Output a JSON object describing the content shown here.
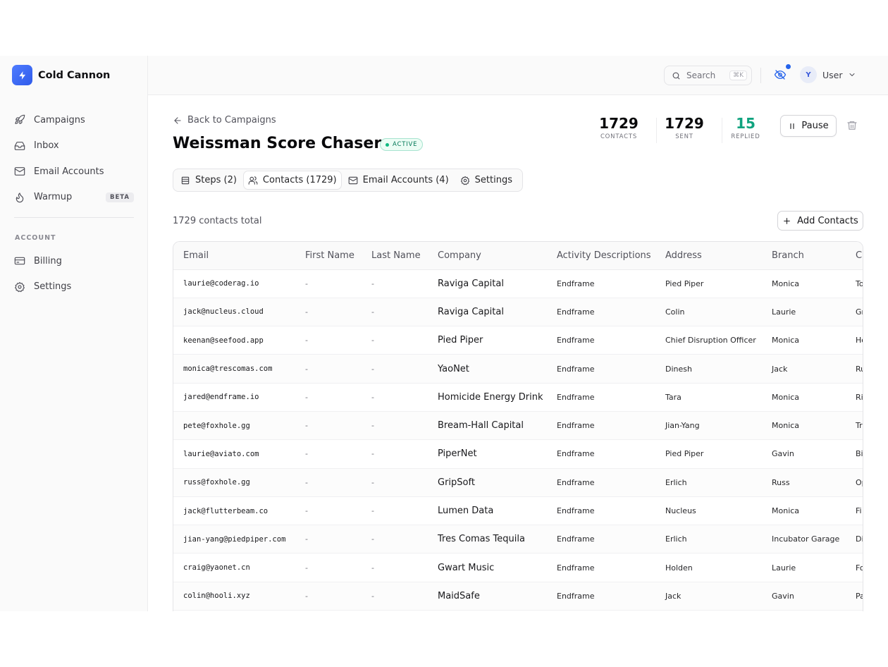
{
  "brand": {
    "name": "Cold Cannon"
  },
  "sidebar": {
    "items": [
      {
        "label": "Campaigns",
        "icon": "rocket-icon"
      },
      {
        "label": "Inbox",
        "icon": "inbox-icon"
      },
      {
        "label": "Email Accounts",
        "icon": "mail-icon"
      },
      {
        "label": "Warmup",
        "icon": "flame-icon",
        "badge": "BETA"
      }
    ],
    "section_label": "ACCOUNT",
    "account_items": [
      {
        "label": "Billing",
        "icon": "credit-card-icon"
      },
      {
        "label": "Settings",
        "icon": "gear-icon"
      }
    ]
  },
  "topbar": {
    "search_label": "Search",
    "search_shortcut": "⌘K",
    "user_initial": "Y",
    "user_label": "User"
  },
  "campaign": {
    "back_label": "Back to Campaigns",
    "title": "Weissman Score Chasers",
    "status": "ACTIVE",
    "stats": [
      {
        "value": "1729",
        "label": "CONTACTS"
      },
      {
        "value": "1729",
        "label": "SENT"
      },
      {
        "value": "15",
        "label": "REPLIED"
      }
    ],
    "pause_label": "Pause"
  },
  "tabs": [
    {
      "label": "Steps (2)",
      "icon": "list-icon",
      "active": false
    },
    {
      "label": "Contacts (1729)",
      "icon": "users-icon",
      "active": true
    },
    {
      "label": "Email Accounts (4)",
      "icon": "mail-icon",
      "active": false
    },
    {
      "label": "Settings",
      "icon": "gear-icon",
      "active": false
    }
  ],
  "contacts": {
    "total_label": "1729 contacts total",
    "add_label": "Add Contacts",
    "columns": [
      "Email",
      "First Name",
      "Last Name",
      "Company",
      "Activity Descriptions",
      "Address",
      "Branch",
      "C"
    ],
    "rows": [
      [
        "laurie@coderag.io",
        "-",
        "-",
        "Raviga Capital",
        "Endframe",
        "Pied Piper",
        "Monica",
        "To"
      ],
      [
        "jack@nucleus.cloud",
        "-",
        "-",
        "Raviga Capital",
        "Endframe",
        "Colin",
        "Laurie",
        "Gr"
      ],
      [
        "keenan@seefood.app",
        "-",
        "-",
        "Pied Piper",
        "Endframe",
        "Chief Disruption Officer",
        "Monica",
        "Ho"
      ],
      [
        "monica@trescomas.com",
        "-",
        "-",
        "YaoNet",
        "Endframe",
        "Dinesh",
        "Jack",
        "Ru"
      ],
      [
        "jared@endframe.io",
        "-",
        "-",
        "Homicide Energy Drink",
        "Endframe",
        "Tara",
        "Monica",
        "Ri"
      ],
      [
        "pete@foxhole.gg",
        "-",
        "-",
        "Bream-Hall Capital",
        "Endframe",
        "Jian-Yang",
        "Monica",
        "Tr"
      ],
      [
        "laurie@aviato.com",
        "-",
        "-",
        "PiperNet",
        "Endframe",
        "Pied Piper",
        "Gavin",
        "Bi"
      ],
      [
        "russ@foxhole.gg",
        "-",
        "-",
        "GripSoft",
        "Endframe",
        "Erlich",
        "Russ",
        "Op"
      ],
      [
        "jack@flutterbeam.co",
        "-",
        "-",
        "Lumen Data",
        "Endframe",
        "Nucleus",
        "Monica",
        "Fi"
      ],
      [
        "jian-yang@piedpiper.com",
        "-",
        "-",
        "Tres Comas Tequila",
        "Endframe",
        "Erlich",
        "Incubator Garage",
        "Di"
      ],
      [
        "craig@yaonet.cn",
        "-",
        "-",
        "Gwart Music",
        "Endframe",
        "Holden",
        "Laurie",
        "Fo"
      ],
      [
        "colin@hooli.xyz",
        "-",
        "-",
        "MaidSafe",
        "Endframe",
        "Jack",
        "Gavin",
        "Pa"
      ]
    ]
  },
  "colors": {
    "accent": "#3b64f5",
    "replied": "#10a37f",
    "status_green": "#047857"
  }
}
